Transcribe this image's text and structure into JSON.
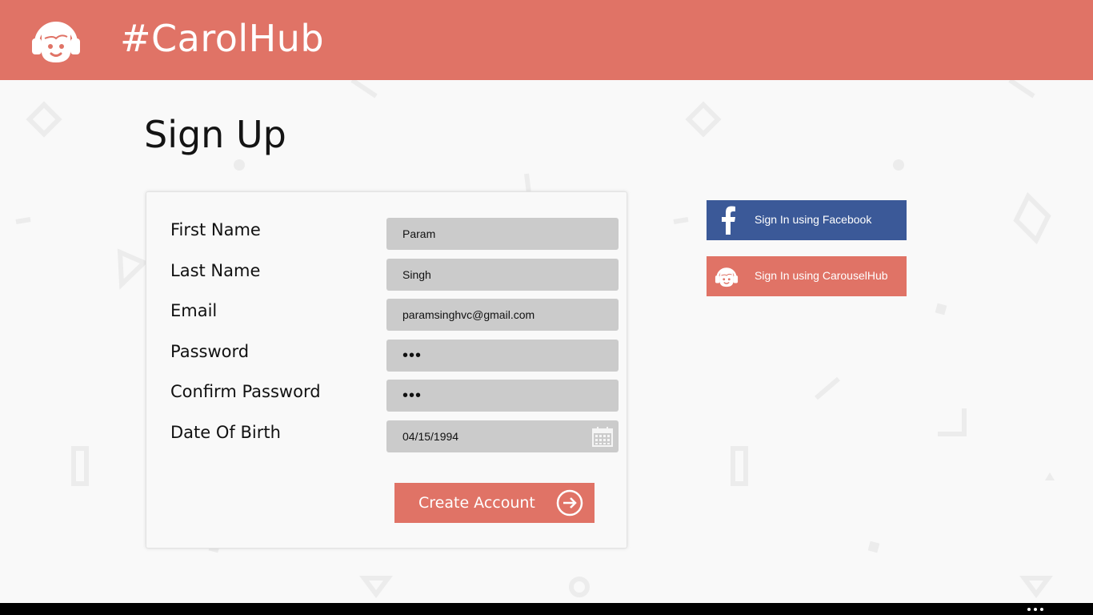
{
  "header": {
    "app_title": "#CarolHub",
    "brand_color": "#e07366"
  },
  "page": {
    "title": "Sign Up"
  },
  "form": {
    "fields": [
      {
        "label": "First Name",
        "value": "Param"
      },
      {
        "label": "Last Name",
        "value": "Singh"
      },
      {
        "label": "Email",
        "value": "paramsinghvc@gmail.com"
      },
      {
        "label": "Password",
        "value": "•••"
      },
      {
        "label": "Confirm Password",
        "value": "•••"
      },
      {
        "label": "Date Of Birth",
        "value": "04/15/1994"
      }
    ],
    "submit_label": "Create Account"
  },
  "social": {
    "facebook_label": "Sign In using Facebook",
    "facebook_color": "#3b5998",
    "carousel_label": "Sign In using CarouselHub"
  },
  "icons": {
    "logo": "headphones-face-icon",
    "date": "calendar-icon",
    "submit": "arrow-right-circle-icon",
    "facebook": "facebook-icon",
    "carousel": "headphones-face-icon",
    "more": "more-icon"
  }
}
